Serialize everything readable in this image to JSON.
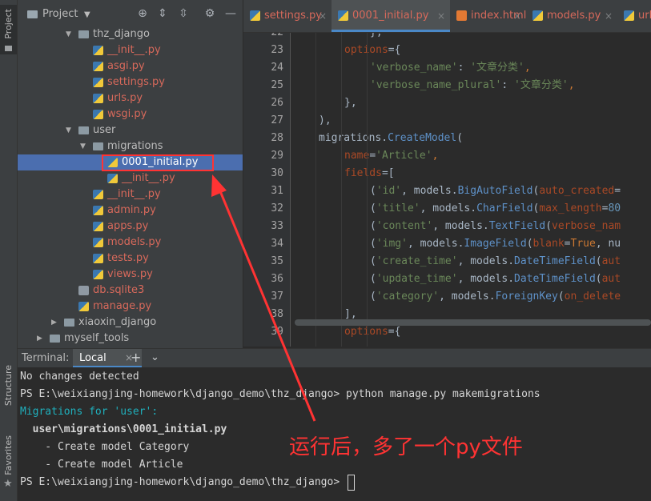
{
  "left_strip": {
    "project": "Project",
    "structure": "Structure",
    "favorites": "Favorites"
  },
  "project_panel": {
    "title": "Project",
    "tree": [
      {
        "label": "thz_django",
        "type": "folder",
        "depth": 3,
        "expanded": true,
        "color": "grey"
      },
      {
        "label": "__init__.py",
        "type": "py",
        "depth": 4,
        "color": "red"
      },
      {
        "label": "asgi.py",
        "type": "py",
        "depth": 4,
        "color": "red"
      },
      {
        "label": "settings.py",
        "type": "py",
        "depth": 4,
        "color": "red"
      },
      {
        "label": "urls.py",
        "type": "py",
        "depth": 4,
        "color": "red"
      },
      {
        "label": "wsgi.py",
        "type": "py",
        "depth": 4,
        "color": "red"
      },
      {
        "label": "user",
        "type": "folder",
        "depth": 3,
        "expanded": true,
        "color": "grey"
      },
      {
        "label": "migrations",
        "type": "folder",
        "depth": 4,
        "expanded": true,
        "color": "grey"
      },
      {
        "label": "0001_initial.py",
        "type": "py",
        "depth": 5,
        "color": "blue",
        "selected": true
      },
      {
        "label": "__init__.py",
        "type": "py",
        "depth": 5,
        "color": "red"
      },
      {
        "label": "__init__.py",
        "type": "py",
        "depth": 4,
        "color": "red"
      },
      {
        "label": "admin.py",
        "type": "py",
        "depth": 4,
        "color": "red"
      },
      {
        "label": "apps.py",
        "type": "py",
        "depth": 4,
        "color": "red"
      },
      {
        "label": "models.py",
        "type": "py",
        "depth": 4,
        "color": "red"
      },
      {
        "label": "tests.py",
        "type": "py",
        "depth": 4,
        "color": "red"
      },
      {
        "label": "views.py",
        "type": "py",
        "depth": 4,
        "color": "red"
      },
      {
        "label": "db.sqlite3",
        "type": "db",
        "depth": 3,
        "color": "red"
      },
      {
        "label": "manage.py",
        "type": "py",
        "depth": 3,
        "color": "red"
      },
      {
        "label": "xiaoxin_django",
        "type": "folder",
        "depth": 2,
        "expanded": false,
        "color": "grey"
      },
      {
        "label": "myself_tools",
        "type": "folder",
        "depth": 1,
        "expanded": false,
        "color": "grey"
      }
    ]
  },
  "tabs": [
    {
      "label": "settings.py",
      "type": "py",
      "color": "#d7695b",
      "active": false
    },
    {
      "label": "0001_initial.py",
      "type": "py",
      "color": "#d7695b",
      "active": true
    },
    {
      "label": "index.html",
      "type": "html",
      "color": "#d7695b",
      "active": false
    },
    {
      "label": "models.py",
      "type": "py",
      "color": "#d7695b",
      "active": false
    },
    {
      "label": "urls",
      "type": "py",
      "color": "#d7695b",
      "active": false
    }
  ],
  "editor": {
    "lines": [
      {
        "n": "22",
        "indent": 3,
        "tokens": [
          [
            "},",
            "plain"
          ]
        ]
      },
      {
        "n": "23",
        "indent": 2,
        "tokens": [
          [
            "options",
            "param"
          ],
          [
            "={",
            "plain"
          ]
        ]
      },
      {
        "n": "24",
        "indent": 3,
        "tokens": [
          [
            "'verbose_name'",
            "green"
          ],
          [
            ": ",
            "plain"
          ],
          [
            "'文章分类'",
            "green"
          ],
          [
            ",",
            "orange"
          ]
        ]
      },
      {
        "n": "25",
        "indent": 3,
        "tokens": [
          [
            "'verbose_name_plural'",
            "green"
          ],
          [
            ": ",
            "plain"
          ],
          [
            "'文章分类'",
            "green"
          ],
          [
            ",",
            "orange"
          ]
        ]
      },
      {
        "n": "26",
        "indent": 2,
        "tokens": [
          [
            "},",
            "plain"
          ]
        ]
      },
      {
        "n": "27",
        "indent": 1,
        "tokens": [
          [
            "),",
            "plain"
          ]
        ]
      },
      {
        "n": "28",
        "indent": 1,
        "tokens": [
          [
            "migrations",
            "plain"
          ],
          [
            ".",
            "plain"
          ],
          [
            "CreateModel",
            "func"
          ],
          [
            "(",
            "plain"
          ]
        ]
      },
      {
        "n": "29",
        "indent": 2,
        "tokens": [
          [
            "name",
            "param"
          ],
          [
            "=",
            "plain"
          ],
          [
            "'Article'",
            "green"
          ],
          [
            ",",
            "orange"
          ]
        ]
      },
      {
        "n": "30",
        "indent": 2,
        "tokens": [
          [
            "fields",
            "param"
          ],
          [
            "=[",
            "plain"
          ]
        ]
      },
      {
        "n": "31",
        "indent": 3,
        "tokens": [
          [
            "(",
            "plain"
          ],
          [
            "'id'",
            "green"
          ],
          [
            ", models.",
            "plain"
          ],
          [
            "BigAutoField",
            "func"
          ],
          [
            "(",
            "plain"
          ],
          [
            "auto_created",
            "param"
          ],
          [
            "=",
            "plain"
          ]
        ]
      },
      {
        "n": "32",
        "indent": 3,
        "tokens": [
          [
            "(",
            "plain"
          ],
          [
            "'title'",
            "green"
          ],
          [
            ", models.",
            "plain"
          ],
          [
            "CharField",
            "func"
          ],
          [
            "(",
            "plain"
          ],
          [
            "max_length",
            "param"
          ],
          [
            "=",
            "plain"
          ],
          [
            "80",
            "num"
          ]
        ]
      },
      {
        "n": "33",
        "indent": 3,
        "tokens": [
          [
            "(",
            "plain"
          ],
          [
            "'content'",
            "green"
          ],
          [
            ", models.",
            "plain"
          ],
          [
            "TextField",
            "func"
          ],
          [
            "(",
            "plain"
          ],
          [
            "verbose_nam",
            "param"
          ]
        ]
      },
      {
        "n": "34",
        "indent": 3,
        "tokens": [
          [
            "(",
            "plain"
          ],
          [
            "'img'",
            "green"
          ],
          [
            ", models.",
            "plain"
          ],
          [
            "ImageField",
            "func"
          ],
          [
            "(",
            "plain"
          ],
          [
            "blank",
            "param"
          ],
          [
            "=",
            "plain"
          ],
          [
            "True",
            "orange"
          ],
          [
            ", nu",
            "plain"
          ]
        ]
      },
      {
        "n": "35",
        "indent": 3,
        "tokens": [
          [
            "(",
            "plain"
          ],
          [
            "'create_time'",
            "green"
          ],
          [
            ", models.",
            "plain"
          ],
          [
            "DateTimeField",
            "func"
          ],
          [
            "(",
            "plain"
          ],
          [
            "aut",
            "param"
          ]
        ]
      },
      {
        "n": "36",
        "indent": 3,
        "tokens": [
          [
            "(",
            "plain"
          ],
          [
            "'update_time'",
            "green"
          ],
          [
            ", models.",
            "plain"
          ],
          [
            "DateTimeField",
            "func"
          ],
          [
            "(",
            "plain"
          ],
          [
            "aut",
            "param"
          ]
        ]
      },
      {
        "n": "37",
        "indent": 3,
        "tokens": [
          [
            "(",
            "plain"
          ],
          [
            "'category'",
            "green"
          ],
          [
            ", models.",
            "plain"
          ],
          [
            "ForeignKey",
            "func"
          ],
          [
            "(",
            "plain"
          ],
          [
            "on_delete",
            "param"
          ]
        ]
      },
      {
        "n": "38",
        "indent": 2,
        "tokens": [
          [
            "],",
            "plain"
          ]
        ]
      },
      {
        "n": "39",
        "indent": 2,
        "tokens": [
          [
            "options",
            "param"
          ],
          [
            "={",
            "plain"
          ]
        ]
      }
    ]
  },
  "terminal": {
    "label": "Terminal:",
    "tab": "Local",
    "lines": [
      {
        "text": "No changes detected",
        "style": "normal"
      },
      {
        "text": "PS E:\\weixiangjing-homework\\django_demo\\thz_django> python manage.py makemigrations",
        "style": "normal"
      },
      {
        "text": "Migrations for 'user':",
        "style": "cyan"
      },
      {
        "text": "  user\\migrations\\0001_initial.py",
        "style": "bold"
      },
      {
        "text": "    - Create model Category",
        "style": "normal"
      },
      {
        "text": "    - Create model Article",
        "style": "normal"
      },
      {
        "text": "PS E:\\weixiangjing-homework\\django_demo\\thz_django> ",
        "style": "prompt"
      }
    ]
  },
  "annotation": "运行后，多了一个py文件",
  "colors": {
    "accent": "#4a88c7",
    "annotation": "#ff3333",
    "selection": "#4b6eaf"
  }
}
